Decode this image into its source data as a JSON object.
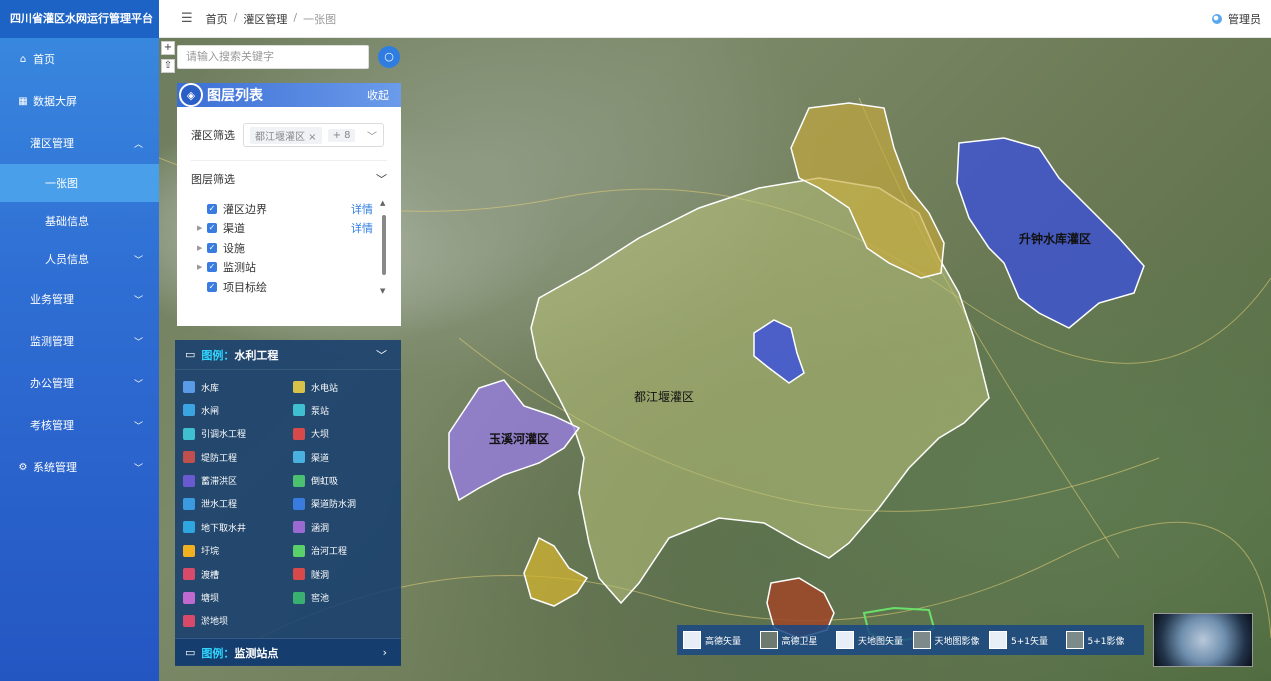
{
  "app": {
    "title": "四川省灌区水网运行管理平台"
  },
  "sidebar": {
    "items": [
      {
        "label": "首页",
        "icon": "home-icon"
      },
      {
        "label": "数据大屏",
        "icon": "grid-icon"
      },
      {
        "label": "灌区管理",
        "expanded": true
      },
      {
        "label": "一张图",
        "active": true
      },
      {
        "label": "基础信息"
      },
      {
        "label": "人员信息"
      },
      {
        "label": "业务管理"
      },
      {
        "label": "监测管理"
      },
      {
        "label": "办公管理"
      },
      {
        "label": "考核管理"
      },
      {
        "label": "系统管理",
        "icon": "gear-icon"
      }
    ]
  },
  "topbar": {
    "breadcrumb": [
      "首页",
      "灌区管理",
      "一张图"
    ],
    "user": "管理员"
  },
  "map": {
    "search_placeholder": "请输入搜索关键字",
    "zoom_in": "+",
    "zoom_reset": "⇧",
    "layer_panel": {
      "title": "图层列表",
      "collapse": "收起",
      "region_filter_label": "灌区筛选",
      "region_tag": "都江堰灌区",
      "region_more": "+ 8",
      "layer_filter_label": "图层筛选",
      "layers": [
        {
          "label": "灌区边界",
          "detail": "详情"
        },
        {
          "label": "渠道",
          "detail": "详情"
        },
        {
          "label": "设施"
        },
        {
          "label": "监测站"
        },
        {
          "label": "项目标绘"
        }
      ]
    },
    "legend": {
      "prefix": "图例：",
      "category": "水利工程",
      "items": [
        {
          "label": "水库",
          "color": "#5a9be8"
        },
        {
          "label": "水电站",
          "color": "#d8c24a"
        },
        {
          "label": "水闸",
          "color": "#3aa5e0"
        },
        {
          "label": "泵站",
          "color": "#3fbfd0"
        },
        {
          "label": "引调水工程",
          "color": "#3fbfd0"
        },
        {
          "label": "大坝",
          "color": "#d84a4a"
        },
        {
          "label": "堤防工程",
          "color": "#c0504d"
        },
        {
          "label": "渠道",
          "color": "#4ab0e0"
        },
        {
          "label": "蓄滞洪区",
          "color": "#6a5ad0"
        },
        {
          "label": "倒虹吸",
          "color": "#4ac070"
        },
        {
          "label": "泄水工程",
          "color": "#3a9be0"
        },
        {
          "label": "渠道防水洞",
          "color": "#3a7be0"
        },
        {
          "label": "地下取水井",
          "color": "#2fa6e0"
        },
        {
          "label": "涵洞",
          "color": "#9a6ad0"
        },
        {
          "label": "圩垸",
          "color": "#f0b020"
        },
        {
          "label": "治河工程",
          "color": "#5ad06a"
        },
        {
          "label": "渡槽",
          "color": "#d84a6a"
        },
        {
          "label": "隧洞",
          "color": "#d84a4a"
        },
        {
          "label": "塘坝",
          "color": "#c06ad0"
        },
        {
          "label": "窖池",
          "color": "#3ab070"
        },
        {
          "label": "淤地坝",
          "color": "#d84a6a"
        }
      ],
      "category2": "监测站点"
    },
    "regions": [
      {
        "name": "升钟水库灌区",
        "color": "#3a4fe0"
      },
      {
        "name": "都江堰灌区",
        "color": "#b9c27a"
      },
      {
        "name": "玉溪河灌区",
        "color": "#9a7ee8"
      }
    ],
    "basemaps": [
      "高德矢量",
      "高德卫星",
      "天地图矢量",
      "天地图影像",
      "5+1矢量",
      "5+1影像"
    ]
  }
}
